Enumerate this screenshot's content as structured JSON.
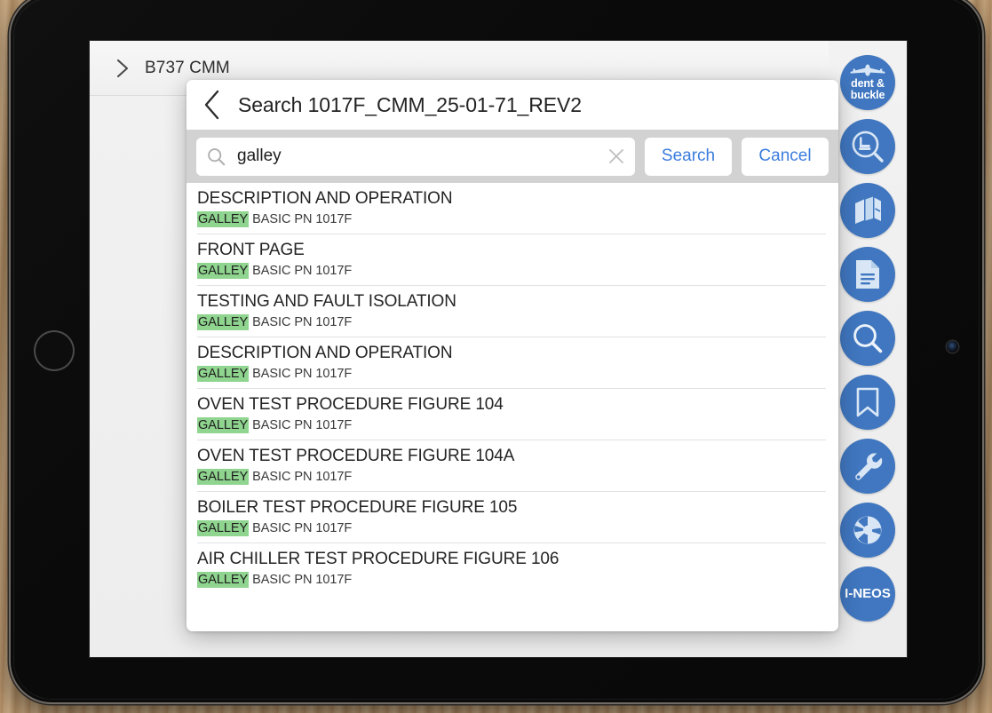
{
  "device": {
    "type": "tablet",
    "orientation": "landscape",
    "home_button": "home-button",
    "camera": "front-camera"
  },
  "app": {
    "breadcrumb": {
      "chevron_icon": "chevron-right-icon",
      "label": "B737 CMM"
    }
  },
  "icon_rail": {
    "items": [
      {
        "name": "dent-and-buckle",
        "icon": "airplane-icon",
        "label_line1": "dent &",
        "label_line2": "buckle",
        "color": "#4077c0"
      },
      {
        "name": "seat-inspection",
        "icon": "seat-magnifier-icon",
        "label": "",
        "color": "#4077c0"
      },
      {
        "name": "manuals",
        "icon": "books-icon",
        "label": "",
        "color": "#4077c0"
      },
      {
        "name": "documents",
        "icon": "document-icon",
        "label": "",
        "color": "#4077c0"
      },
      {
        "name": "search",
        "icon": "magnifier-icon",
        "label": "",
        "color": "#4077c0"
      },
      {
        "name": "bookmarks",
        "icon": "bookmark-icon",
        "label": "",
        "color": "#4077c0"
      },
      {
        "name": "tools",
        "icon": "wrench-icon",
        "label": "",
        "color": "#4077c0"
      },
      {
        "name": "camera",
        "icon": "aperture-icon",
        "label": "",
        "color": "#4077c0"
      },
      {
        "name": "i-neos",
        "icon": "text-label",
        "label": "I-NEOS",
        "color": "#4077c0"
      }
    ]
  },
  "modal": {
    "back_icon": "back-chevron-icon",
    "title": "Search 1017F_CMM_25-01-71_REV2",
    "search": {
      "icon": "search-icon",
      "value": "galley",
      "placeholder": "Search",
      "clear_icon": "clear-x-icon"
    },
    "buttons": {
      "search_label": "Search",
      "cancel_label": "Cancel",
      "accent_color": "#3b7ddd"
    },
    "results": {
      "highlight_color": "#8fd48f",
      "highlight_term": "GALLEY",
      "rows": [
        {
          "title": "DESCRIPTION AND OPERATION",
          "match": "GALLEY",
          "subtitle": " BASIC PN 1017F"
        },
        {
          "title": "FRONT PAGE",
          "match": "GALLEY",
          "subtitle": " BASIC PN 1017F"
        },
        {
          "title": "TESTING AND FAULT ISOLATION",
          "match": "GALLEY",
          "subtitle": " BASIC PN 1017F"
        },
        {
          "title": "DESCRIPTION AND OPERATION",
          "match": "GALLEY",
          "subtitle": " BASIC PN 1017F"
        },
        {
          "title": "OVEN TEST PROCEDURE FIGURE 104",
          "match": "GALLEY",
          "subtitle": " BASIC PN 1017F"
        },
        {
          "title": "OVEN TEST PROCEDURE FIGURE 104A",
          "match": "GALLEY",
          "subtitle": " BASIC PN 1017F"
        },
        {
          "title": "BOILER TEST PROCEDURE FIGURE 105",
          "match": "GALLEY",
          "subtitle": " BASIC PN 1017F"
        },
        {
          "title": "AIR CHILLER TEST PROCEDURE FIGURE 106",
          "match": "GALLEY",
          "subtitle": " BASIC PN 1017F"
        }
      ]
    }
  }
}
